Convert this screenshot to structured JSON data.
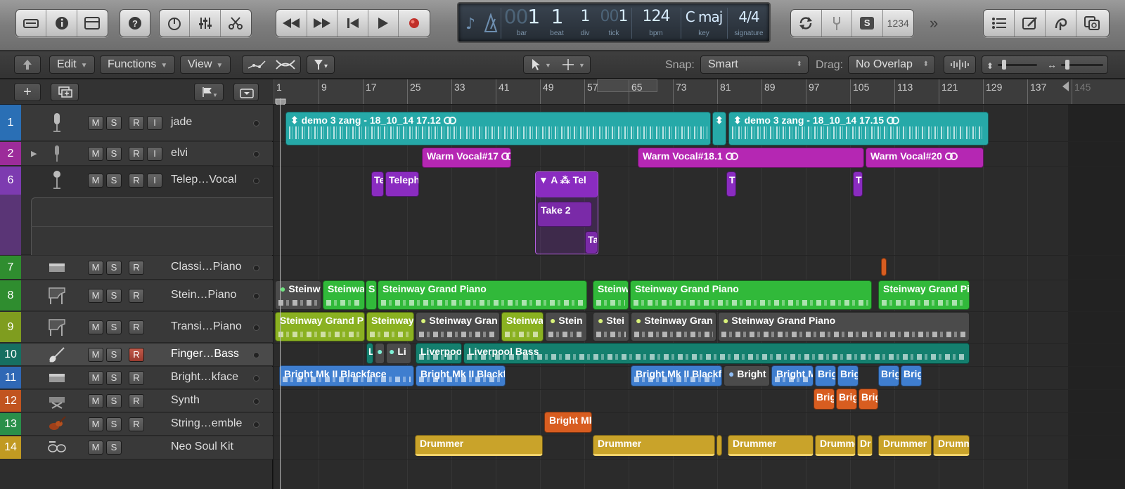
{
  "lcd": {
    "bar": "1",
    "bar_label": "bar",
    "beat": "1",
    "beat_label": "beat",
    "div": "1",
    "div_label": "div",
    "tick": "1",
    "tick_label": "tick",
    "bpm": "124",
    "bpm_label": "bpm",
    "key": "C maj",
    "key_label": "key",
    "signature": "4/4",
    "signature_label": "signature"
  },
  "control_bar": {
    "solo_label": "S",
    "count_label": "1234",
    "more_label": "»"
  },
  "toolbar": {
    "edit": "Edit",
    "functions": "Functions",
    "view": "View",
    "snap_label": "Snap:",
    "snap_value": "Smart",
    "drag_label": "Drag:",
    "drag_value": "No Overlap"
  },
  "ruler": [
    "1",
    "9",
    "17",
    "25",
    "33",
    "41",
    "49",
    "57",
    "65",
    "73",
    "81",
    "89",
    "97",
    "105",
    "113",
    "121",
    "129",
    "137",
    "145"
  ],
  "tracks": [
    {
      "num": "1",
      "name": "jade",
      "color": "#2a6fb5",
      "buttons": [
        "M",
        "S",
        "R",
        "I"
      ]
    },
    {
      "num": "2",
      "name": "elvi",
      "color": "#9c2c9a",
      "buttons": [
        "M",
        "S",
        "R",
        "I"
      ]
    },
    {
      "num": "6",
      "name": "Telep…Vocal",
      "color": "#7d3bb0",
      "buttons": [
        "M",
        "S",
        "R",
        "I"
      ]
    },
    {
      "num": "7",
      "name": "Classi…Piano",
      "color": "#2f8d2f",
      "buttons": [
        "M",
        "S",
        "R"
      ]
    },
    {
      "num": "8",
      "name": "Stein…Piano",
      "color": "#2f8d2f",
      "buttons": [
        "M",
        "S",
        "R"
      ]
    },
    {
      "num": "9",
      "name": "Transi…Piano",
      "color": "#7f9d1f",
      "buttons": [
        "M",
        "S",
        "R"
      ]
    },
    {
      "num": "10",
      "name": "Finger…Bass",
      "color": "#166f61",
      "buttons": [
        "M",
        "S",
        "R"
      ]
    },
    {
      "num": "11",
      "name": "Bright…kface",
      "color": "#2f68b5",
      "buttons": [
        "M",
        "S",
        "R"
      ]
    },
    {
      "num": "12",
      "name": "Synth",
      "color": "#c1541f",
      "buttons": [
        "M",
        "S",
        "R"
      ]
    },
    {
      "num": "13",
      "name": "String…emble",
      "color": "#2a8f4a",
      "buttons": [
        "M",
        "S",
        "R"
      ]
    },
    {
      "num": "14",
      "name": "Neo Soul Kit",
      "color": "#c19a22",
      "buttons": [
        "M",
        "S"
      ]
    }
  ],
  "regions": {
    "demo1": "demo 3 zang - 18_10_14 17.12",
    "demo2": "demo 3 zang - 18_10_14 17.15",
    "wv17": "Warm Vocal#17",
    "wv18": "Warm Vocal#18.1",
    "wv20": "Warm Vocal#20",
    "te": "Te",
    "teleph": "Teleph",
    "tel": "Tel",
    "take2": "Take 2",
    "ta": "Ta",
    "t": "T",
    "stein_short": "Steinw",
    "steinway_short": "Steinwa",
    "stein_s": "S",
    "steinway": "Steinway Grand Piano",
    "stein_gp_cut": "Steinway Grand Pia",
    "steinway_6": "Steinway",
    "stein_gran": "Steinway Gran",
    "stein_5": "Stein",
    "stein_4": "Stei",
    "stein_gran2": "Steinway Gran",
    "liv1": "Liverpool",
    "liv2": "Liverpool Bass",
    "l": "L",
    "li": "Li",
    "bright1": "Bright Mk II Blackface",
    "bright2": "Bright Mk II Blackf",
    "bright3": "Bright Mk II Blackfa",
    "bright4": "Bright",
    "bright5": "Bright M",
    "brig": "Brig",
    "brightmk": "Bright Mk",
    "drummer": "Drummer",
    "drumme": "Drumme",
    "dr": "Dr",
    "drumm": "Drumm",
    "take_folder_a": "A"
  }
}
